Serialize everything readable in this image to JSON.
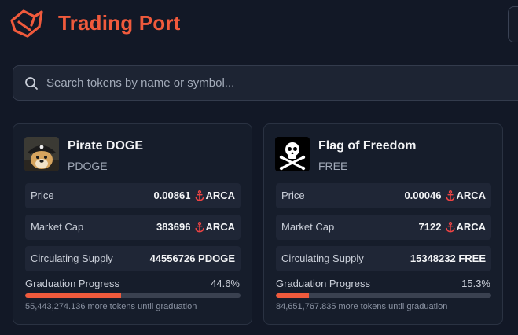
{
  "header": {
    "title": "Trading Port",
    "logo_icon": "pirate-ship-logo-icon"
  },
  "search": {
    "placeholder": "Search tokens by name or symbol...",
    "value": ""
  },
  "colors": {
    "accent": "#f05a3c",
    "background": "#121826",
    "card": "#161d2b"
  },
  "tokens": [
    {
      "name": "Pirate DOGE",
      "symbol": "PDOGE",
      "avatar_icon": "pirate-doge-avatar",
      "price_label": "Price",
      "price_value": "0.00861",
      "market_cap_label": "Market Cap",
      "market_cap_value": "383696",
      "supply_label": "Circulating Supply",
      "supply_value": "44556726 PDOGE",
      "currency": "ARCA",
      "currency_icon": "anchor-icon",
      "graduation_label": "Graduation Progress",
      "graduation_pct_text": "44.6%",
      "graduation_pct": 44.6,
      "remaining_text": "55,443,274.136 more tokens until graduation"
    },
    {
      "name": "Flag of Freedom",
      "symbol": "FREE",
      "avatar_icon": "skull-crossbones-avatar",
      "price_label": "Price",
      "price_value": "0.00046",
      "market_cap_label": "Market Cap",
      "market_cap_value": "7122",
      "supply_label": "Circulating Supply",
      "supply_value": "15348232 FREE",
      "currency": "ARCA",
      "currency_icon": "anchor-icon",
      "graduation_label": "Graduation Progress",
      "graduation_pct_text": "15.3%",
      "graduation_pct": 15.3,
      "remaining_text": "84,651,767.835 more tokens until graduation"
    }
  ]
}
